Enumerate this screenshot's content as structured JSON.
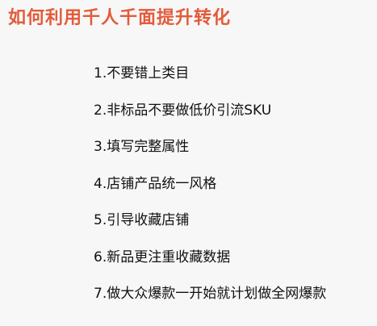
{
  "title": "如何利用千人千面提升转化",
  "items": [
    "1.不要错上类目",
    "2.非标品不要做低价引流SKU",
    "3.填写完整属性",
    "4.店铺产品统一风格",
    "5.引导收藏店铺",
    "6.新品更注重收藏数据",
    "7.做大众爆款一开始就计划做全网爆款"
  ],
  "colors": {
    "title": "#e35b3a",
    "text": "#111111",
    "background": "#f7f7f7"
  }
}
